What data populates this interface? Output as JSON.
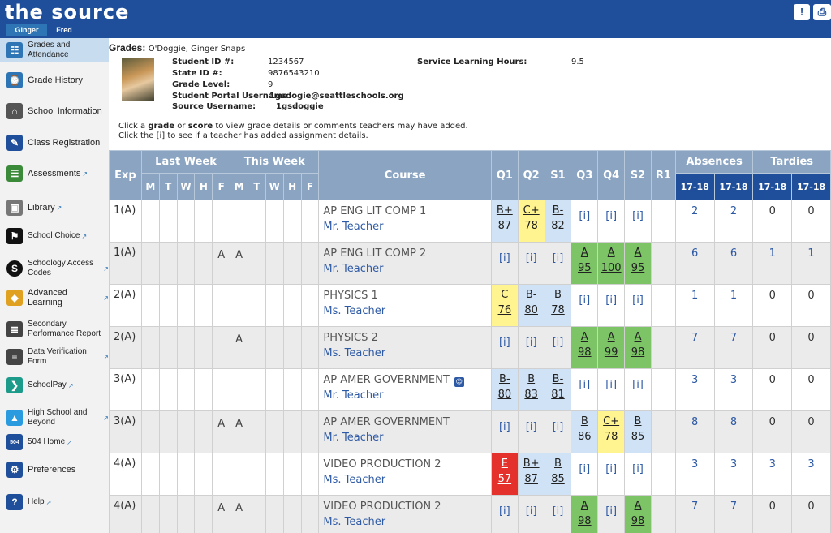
{
  "app": {
    "logo": "the source",
    "user_tabs": [
      "Ginger",
      "Fred"
    ],
    "btn_alert": "!",
    "btn_print": "⎙"
  },
  "sidebar": {
    "items": [
      {
        "label": "Grades and Attendance",
        "ext": false
      },
      {
        "label": "Grade History",
        "ext": false
      },
      {
        "label": "School Information",
        "ext": false
      },
      {
        "label": "Class Registration",
        "ext": false
      },
      {
        "label": "Assessments",
        "ext": true
      },
      {
        "label": "Library",
        "ext": true
      },
      {
        "label": "School Choice",
        "ext": true
      },
      {
        "label": "Schoology Access Codes",
        "ext": true
      },
      {
        "label": "Advanced Learning",
        "ext": true
      },
      {
        "label": "Secondary Performance Report",
        "ext": false
      },
      {
        "label": "Data Verification Form",
        "ext": true
      },
      {
        "label": "SchoolPay",
        "ext": true
      },
      {
        "label": "High School and Beyond",
        "ext": true
      },
      {
        "label": "504 Home",
        "ext": true
      },
      {
        "label": "Preferences",
        "ext": false
      },
      {
        "label": "Help",
        "ext": true
      }
    ]
  },
  "student": {
    "grades_label": "Grades:",
    "name": "O'Doggie, Ginger Snaps",
    "fields": [
      {
        "label": "Student ID #:",
        "value": "1234567"
      },
      {
        "label": "State ID #:",
        "value": "9876543210"
      },
      {
        "label": "Grade Level:",
        "value": "9"
      },
      {
        "label": "Student Portal Username:",
        "value": "1gsdogie@seattleschools.org"
      },
      {
        "label": "Source Username:",
        "value": "1gsdoggie"
      }
    ],
    "service_label": "Service Learning Hours:",
    "service_value": "9.5"
  },
  "note": {
    "line1_a": "Click a ",
    "line1_grade": "grade",
    "line1_b": " or ",
    "line1_score": "score",
    "line1_c": " to view grade details or comments teachers may have added.",
    "line2": "Click the [i] to see if a teacher has added assignment details."
  },
  "table": {
    "h_exp": "Exp",
    "h_lastweek": "Last Week",
    "h_thisweek": "This Week",
    "h_course": "Course",
    "h_q1": "Q1",
    "h_q2": "Q2",
    "h_s1": "S1",
    "h_q3": "Q3",
    "h_q4": "Q4",
    "h_s2": "S2",
    "h_r1": "R1",
    "h_absences": "Absences",
    "h_tardies": "Tardies",
    "year": "17-18",
    "days": [
      "M",
      "T",
      "W",
      "H",
      "F"
    ],
    "rows": [
      {
        "exp": "1(A)",
        "att": [
          "",
          "",
          "",
          "",
          "",
          "",
          "",
          "",
          "",
          ""
        ],
        "course": "AP ENG LIT COMP 1",
        "teacher": "Mr. Teacher",
        "people": false,
        "grades": [
          {
            "l": "B+",
            "s": "87",
            "c": "bl"
          },
          {
            "l": "C+",
            "s": "78",
            "c": "yl"
          },
          {
            "l": "B-",
            "s": "82",
            "c": "bl"
          },
          {
            "i": "[i]"
          },
          {
            "i": "[i]"
          },
          {
            "i": "[i]"
          }
        ],
        "abs": [
          "2",
          "2"
        ],
        "tar": [
          "0",
          "0"
        ]
      },
      {
        "exp": "1(A)",
        "att": [
          "",
          "",
          "",
          "",
          "A",
          "A",
          "",
          "",
          "",
          ""
        ],
        "course": "AP ENG LIT COMP 2",
        "teacher": "Mr. Teacher",
        "people": false,
        "grades": [
          {
            "i": "[i]"
          },
          {
            "i": "[i]"
          },
          {
            "i": "[i]"
          },
          {
            "l": "A",
            "s": "95",
            "c": "gr"
          },
          {
            "l": "A",
            "s": "100",
            "c": "gr"
          },
          {
            "l": "A",
            "s": "95",
            "c": "gr"
          }
        ],
        "abs": [
          "6",
          "6"
        ],
        "tar": [
          "1",
          "1"
        ]
      },
      {
        "exp": "2(A)",
        "att": [
          "",
          "",
          "",
          "",
          "",
          "",
          "",
          "",
          "",
          ""
        ],
        "course": "PHYSICS 1",
        "teacher": "Ms. Teacher",
        "people": false,
        "grades": [
          {
            "l": "C",
            "s": "76",
            "c": "yl"
          },
          {
            "l": "B-",
            "s": "80",
            "c": "bl"
          },
          {
            "l": "B",
            "s": "78",
            "c": "bl"
          },
          {
            "i": "[i]"
          },
          {
            "i": "[i]"
          },
          {
            "i": "[i]"
          }
        ],
        "abs": [
          "1",
          "1"
        ],
        "tar": [
          "0",
          "0"
        ]
      },
      {
        "exp": "2(A)",
        "att": [
          "",
          "",
          "",
          "",
          "",
          "A",
          "",
          "",
          "",
          ""
        ],
        "course": "PHYSICS 2",
        "teacher": "Ms. Teacher",
        "people": false,
        "grades": [
          {
            "i": "[i]"
          },
          {
            "i": "[i]"
          },
          {
            "i": "[i]"
          },
          {
            "l": "A",
            "s": "98",
            "c": "gr"
          },
          {
            "l": "A",
            "s": "99",
            "c": "gr"
          },
          {
            "l": "A",
            "s": "98",
            "c": "gr"
          }
        ],
        "abs": [
          "7",
          "7"
        ],
        "tar": [
          "0",
          "0"
        ]
      },
      {
        "exp": "3(A)",
        "att": [
          "",
          "",
          "",
          "",
          "",
          "",
          "",
          "",
          "",
          ""
        ],
        "course": "AP AMER GOVERNMENT",
        "teacher": "Mr. Teacher",
        "people": true,
        "grades": [
          {
            "l": "B-",
            "s": "80",
            "c": "bl"
          },
          {
            "l": "B",
            "s": "83",
            "c": "bl"
          },
          {
            "l": "B-",
            "s": "81",
            "c": "bl"
          },
          {
            "i": "[i]"
          },
          {
            "i": "[i]"
          },
          {
            "i": "[i]"
          }
        ],
        "abs": [
          "3",
          "3"
        ],
        "tar": [
          "0",
          "0"
        ]
      },
      {
        "exp": "3(A)",
        "att": [
          "",
          "",
          "",
          "",
          "A",
          "A",
          "",
          "",
          "",
          ""
        ],
        "course": "AP AMER GOVERNMENT",
        "teacher": "Mr. Teacher",
        "people": false,
        "grades": [
          {
            "i": "[i]"
          },
          {
            "i": "[i]"
          },
          {
            "i": "[i]"
          },
          {
            "l": "B",
            "s": "86",
            "c": "bl"
          },
          {
            "l": "C+",
            "s": "78",
            "c": "yl"
          },
          {
            "l": "B",
            "s": "85",
            "c": "bl"
          }
        ],
        "abs": [
          "8",
          "8"
        ],
        "tar": [
          "0",
          "0"
        ]
      },
      {
        "exp": "4(A)",
        "att": [
          "",
          "",
          "",
          "",
          "",
          "",
          "",
          "",
          "",
          ""
        ],
        "course": "VIDEO PRODUCTION 2",
        "teacher": "Ms. Teacher",
        "people": false,
        "grades": [
          {
            "l": "E",
            "s": "57",
            "c": "rd"
          },
          {
            "l": "B+",
            "s": "87",
            "c": "bl"
          },
          {
            "l": "B",
            "s": "85",
            "c": "bl"
          },
          {
            "i": "[i]"
          },
          {
            "i": "[i]"
          },
          {
            "i": "[i]"
          }
        ],
        "abs": [
          "3",
          "3"
        ],
        "tar": [
          "3",
          "3"
        ]
      },
      {
        "exp": "4(A)",
        "att": [
          "",
          "",
          "",
          "",
          "A",
          "A",
          "",
          "",
          "",
          ""
        ],
        "course": "VIDEO PRODUCTION 2",
        "teacher": "Ms. Teacher",
        "people": false,
        "grades": [
          {
            "i": "[i]"
          },
          {
            "i": "[i]"
          },
          {
            "i": "[i]"
          },
          {
            "l": "A",
            "s": "98",
            "c": "gr"
          },
          {
            "i": "[i]"
          },
          {
            "l": "A",
            "s": "98",
            "c": "gr"
          }
        ],
        "abs": [
          "7",
          "7"
        ],
        "tar": [
          "0",
          "0"
        ]
      }
    ]
  }
}
